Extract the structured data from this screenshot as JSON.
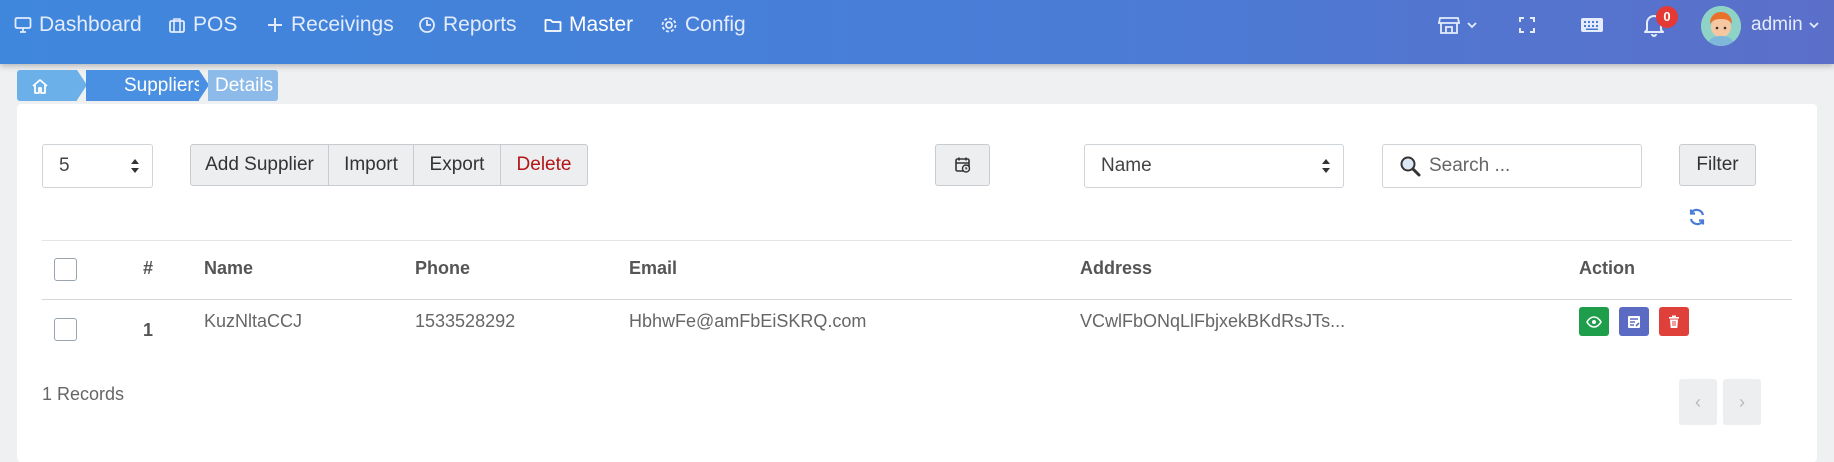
{
  "nav": {
    "items": [
      {
        "label": "Dashboard",
        "icon": "monitor-icon"
      },
      {
        "label": "POS",
        "icon": "briefcase-icon"
      },
      {
        "label": "Receivings",
        "icon": "plus-icon"
      },
      {
        "label": "Reports",
        "icon": "clock-icon"
      },
      {
        "label": "Master",
        "icon": "folder-icon",
        "active": true
      },
      {
        "label": "Config",
        "icon": "gear-icon"
      }
    ],
    "notification_count": "0",
    "user": "admin"
  },
  "breadcrumb": {
    "home_icon": "home-icon",
    "items": [
      "Suppliers",
      "Details"
    ]
  },
  "toolbar": {
    "page_size": "5",
    "add_label": "Add Supplier",
    "import_label": "Import",
    "export_label": "Export",
    "delete_label": "Delete",
    "filter_field": "Name",
    "search_placeholder": "Search ...",
    "filter_label": "Filter"
  },
  "table": {
    "headers": [
      "#",
      "Name",
      "Phone",
      "Email",
      "Address",
      "Action"
    ],
    "rows": [
      {
        "num": "1",
        "name": "KuzNltaCCJ",
        "phone": "1533528292",
        "email": "HbhwFe@amFbEiSKRQ.com",
        "address": "VCwlFbONqLlFbjxekBKdRsJTs..."
      }
    ]
  },
  "footer": {
    "records": "1 Records",
    "prev": "‹",
    "next": "›"
  },
  "colors": {
    "view": "#1e9e4a",
    "edit": "#5b6bc4",
    "delete": "#e0403a",
    "delete_text": "#b31515"
  }
}
